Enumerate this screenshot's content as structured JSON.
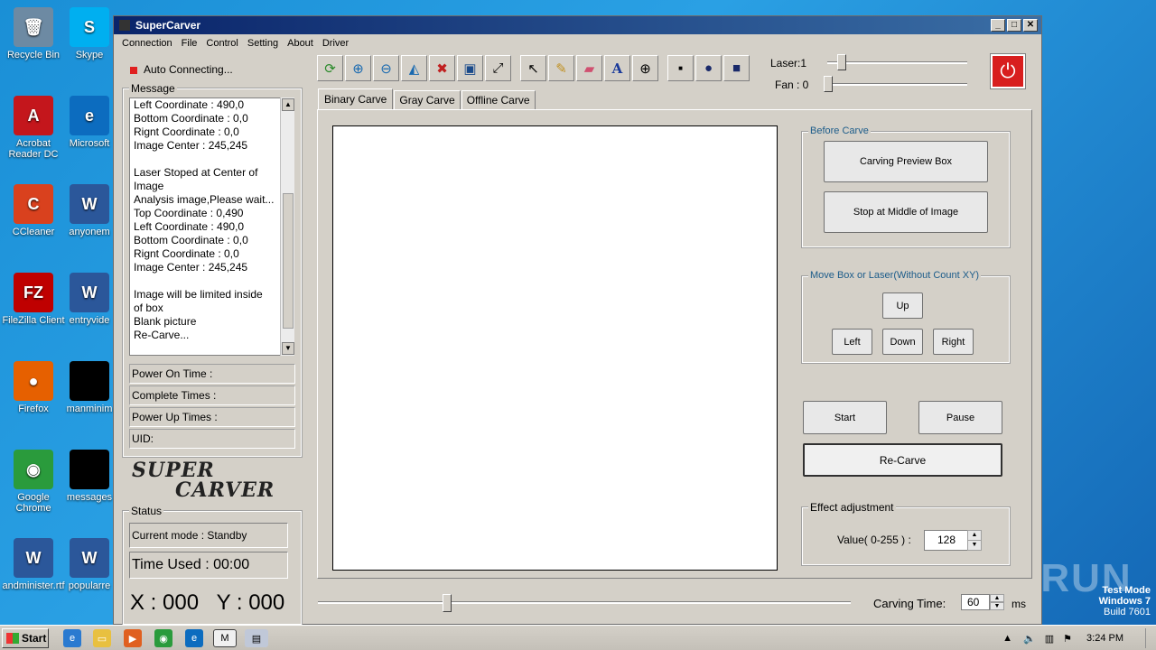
{
  "desktop": {
    "icons": [
      {
        "label": "Recycle Bin",
        "glyph": "🗑",
        "color": "#6d8aa3"
      },
      {
        "label": "Acrobat Reader DC",
        "glyph": "A",
        "color": "#c4161c"
      },
      {
        "label": "CCleaner",
        "glyph": "C",
        "color": "#d9411e"
      },
      {
        "label": "FileZilla Client",
        "glyph": "FZ",
        "color": "#bf0000"
      },
      {
        "label": "Firefox",
        "glyph": "●",
        "color": "#e66000"
      },
      {
        "label": "Google Chrome",
        "glyph": "◉",
        "color": "#2a9b3c"
      },
      {
        "label": "andminister.rtf",
        "glyph": "W",
        "color": "#2b579a"
      }
    ],
    "icons_col2": [
      {
        "label": "Skype",
        "glyph": "S",
        "color": "#00aff0"
      },
      {
        "label": "Microsoft",
        "glyph": "e",
        "color": "#0c6cbf"
      },
      {
        "label": "anyonem",
        "glyph": "W",
        "color": "#2b579a"
      },
      {
        "label": "entryvide",
        "glyph": "W",
        "color": "#2b579a"
      },
      {
        "label": "manminim",
        "glyph": "",
        "color": "#000000"
      },
      {
        "label": "messages",
        "glyph": "",
        "color": "#000000"
      },
      {
        "label": "popularre",
        "glyph": "W",
        "color": "#2b579a"
      }
    ],
    "watermark_lines": [
      "Test Mode",
      "Windows 7",
      "Build 7601"
    ],
    "anyrun": "ANY RUN"
  },
  "window": {
    "title": "SuperCarver",
    "menu": [
      "Connection",
      "File",
      "Control",
      "Setting",
      "About",
      "Driver"
    ],
    "auto_connecting": "Auto Connecting...",
    "message_label": "Message",
    "messages": [
      "Left Coordinate : 490,0",
      "Bottom Coordinate : 0,0",
      "Rignt Coordinate : 0,0",
      "Image Center : 245,245",
      "",
      "Laser Stoped at Center of",
      "Image",
      "Analysis image,Please wait...",
      "Top Coordinate : 0,490",
      "Left Coordinate : 490,0",
      "Bottom Coordinate : 0,0",
      "Rignt Coordinate : 0,0",
      "Image Center : 245,245",
      "",
      "Image will be limited inside",
      "of box",
      "Blank picture",
      "Re-Carve..."
    ],
    "info": {
      "power_on": "Power On Time :",
      "complete": "Complete Times :",
      "power_up": "Power Up Times :",
      "uid": "UID:"
    },
    "logo_line1": "SUPER",
    "logo_line2": "CARVER",
    "status_label": "Status",
    "current_mode": "Current mode : Standby",
    "time_used": "Time Used :  00:00",
    "xy": "X : 000   Y : 000",
    "toolbar_icons": [
      "refresh-icon",
      "zoom-in-icon",
      "zoom-out-icon",
      "flip-icon",
      "delete-icon",
      "save-icon",
      "resize-icon",
      "pointer-icon",
      "pencil-icon",
      "eraser-icon",
      "text-icon",
      "crosshair-icon",
      "dot-small-icon",
      "dot-medium-icon",
      "dot-large-icon"
    ],
    "laser_label": "Laser:1",
    "fan_label": "Fan : 0",
    "tabs": [
      "Binary Carve",
      "Gray Carve",
      "Offline Carve"
    ],
    "before_carve_label": "Before Carve",
    "carving_preview": "Carving Preview Box",
    "stop_middle": "Stop at Middle of Image",
    "move_label": "Move Box or Laser(Without Count XY)",
    "up": "Up",
    "left": "Left",
    "down": "Down",
    "right": "Right",
    "start": "Start",
    "pause": "Pause",
    "recarve": "Re-Carve",
    "effect_label": "Effect adjustment",
    "value_label": "Value( 0-255 ) :",
    "value": "128",
    "carving_time_label": "Carving Time:",
    "carving_time": "60",
    "ms": "ms"
  },
  "taskbar": {
    "start": "Start",
    "clock": "3:24 PM"
  }
}
